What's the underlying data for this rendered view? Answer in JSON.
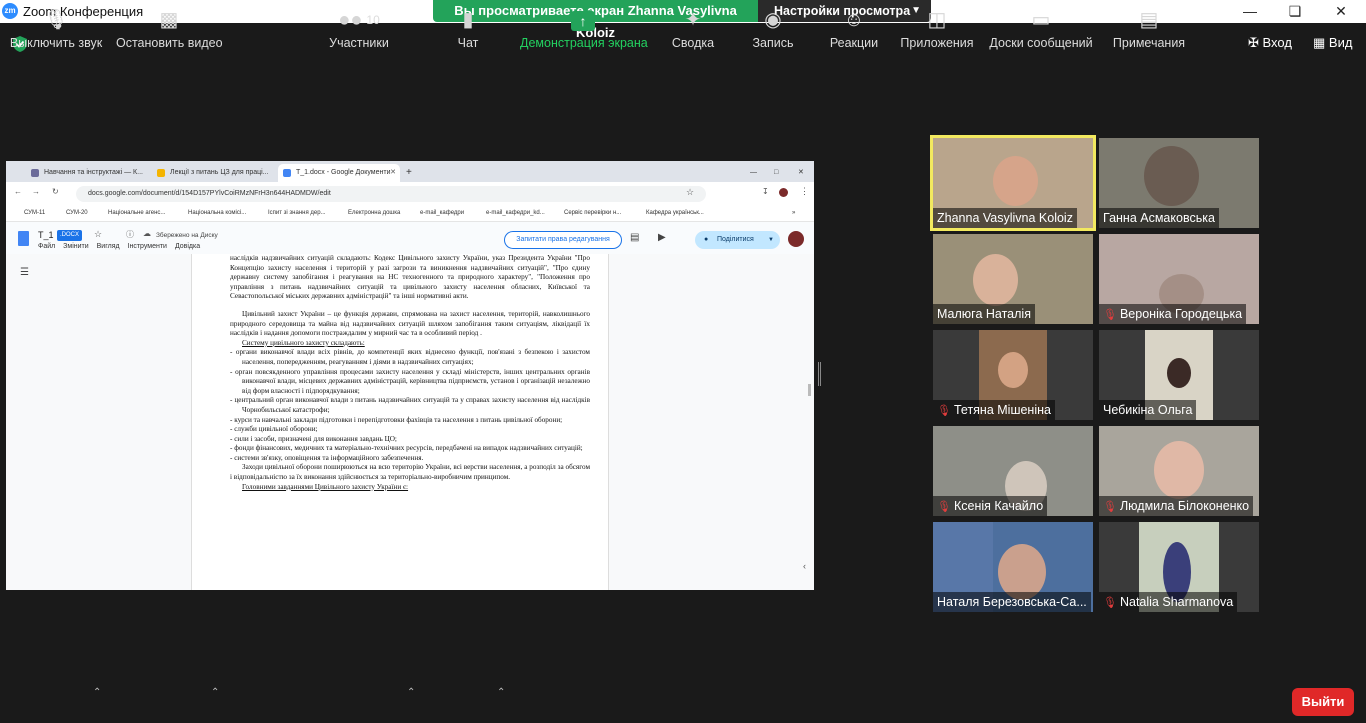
{
  "window": {
    "title": "Zoom Конференция",
    "app_icon_text": "zm"
  },
  "banner": {
    "viewing": "Вы просматриваете экран Zhanna Vasylivna Koloiz",
    "view_options": "Настройки просмотра"
  },
  "top_right": {
    "enter": "Вход",
    "view": "Вид"
  },
  "browser": {
    "tabs": [
      {
        "label": "Навчання та інструктажі — К...",
        "active": false
      },
      {
        "label": "Лекції з питань ЦЗ для праці...",
        "active": false
      },
      {
        "label": "T_1.docx - Google Документи",
        "active": true
      }
    ],
    "url": "docs.google.com/document/d/154D157PYlvCoiRMzNFrH3n644HADMDW/edit",
    "bookmarks": [
      "СУМ-11",
      "СУМ-20",
      "Національне агенс...",
      "Національна комісі...",
      "Іспит зі знання дер...",
      "Електронна дошка",
      "e-mail_кафедри",
      "e-mail_кафедри_kd...",
      "Сервіс перевірки н...",
      "Кафедра українськ..."
    ]
  },
  "docs": {
    "title": "T_1",
    "badge": ".DOCX",
    "saved": "Збережено на Диску",
    "menus": [
      "Файл",
      "Змінити",
      "Вигляд",
      "Інструменти",
      "Довідка"
    ],
    "request_edit": "Запитати права редагування",
    "share": "Поділитися"
  },
  "document": {
    "lines": [
      {
        "text": "наслідків надзвичайних ситуацій складають: Кодекс Цивільного захисту України, указ Президента України \"Про Концепцію захисту населення і територій у разі загрози та виникнення надзвичайних ситуацій\", \"Про єдину державну систему запобігання і реагування на НС техногенного та природного характеру\", \"Положення про управління з питань надзвичайних ситуацій та цивільного захисту населення обласних, Київської та Севастопольської міських державних адміністрацій\" та інші нормативні акти.",
        "style": "para"
      },
      {
        "text": "",
        "style": "gap"
      },
      {
        "text": "Цивільний захист України – це функція держави, спрямована на захист населення, територій, навколишнього природного середовища та майна від надзвичайних ситуацій шляхом запобігання таким ситуаціям, ліквідації їх наслідків і надання допомоги постраждалим у мирний час та в особливий період .",
        "style": "ind"
      },
      {
        "text": "Систему цивільного захисту складають:",
        "style": "ind-u"
      },
      {
        "text": "-    органи виконавчої влади всіх рівнів, до компетенції яких віднесено функції, пов'язані з безпекою і захистом населення, попередженням, реагуванням і діями в надзвичайних ситуаціях;",
        "style": "li"
      },
      {
        "text": "-    орган повсякденного управління процесами захисту населення у складі міністерств, інших центральних органів виконавчої влади, місцевих державних адміністрацій, керівництва підприємств, установ і організацій незалежно від форм власності і підпорядкування;",
        "style": "li"
      },
      {
        "text": "-    центральний орган виконавчої влади з питань надзвичайних ситуацій та у справах захисту населення від наслідків Чорнобильської катастрофи;",
        "style": "li"
      },
      {
        "text": "-    курси та навчальні заклади підготовки і перепідготовки фахівців та населення з питань цивільної оборони;",
        "style": "li"
      },
      {
        "text": "-    служби цивільної оборони;",
        "style": "li"
      },
      {
        "text": "-    сили і засоби, призначені для виконання завдань ЦО;",
        "style": "li"
      },
      {
        "text": "-    фонди фінансових, медичних та матеріально-технічних ресурсів, передбачені на випадок надзвичайних ситуацій;",
        "style": "li"
      },
      {
        "text": "-    системи зв'язку, оповіщення та інформаційного забезпечення.",
        "style": "li"
      },
      {
        "text": "Заходи цивільної оборони поширюються на всю територію України, всі верстви населення, а розподіл за обсягом і відповідальністю за їх виконання здійснюється за територіально-виробничим принципом.",
        "style": "ind"
      },
      {
        "text": "Головними завданнями Цивільного захисту  України є:",
        "style": "ind-u"
      }
    ]
  },
  "participants": [
    {
      "name": "Zhanna Vasylivna Koloiz",
      "muted": false,
      "speaking": true
    },
    {
      "name": "Ганна Асмаковська",
      "muted": false,
      "speaking": false
    },
    {
      "name": "Малюга Наталія",
      "muted": false,
      "speaking": false
    },
    {
      "name": "Вероніка Городецька",
      "muted": true,
      "speaking": false
    },
    {
      "name": "Тетяна Мішеніна",
      "muted": true,
      "speaking": false
    },
    {
      "name": "Чебикіна Ольга",
      "muted": false,
      "speaking": false
    },
    {
      "name": "Ксенія Качайло",
      "muted": true,
      "speaking": false
    },
    {
      "name": "Людмила Білоконенко",
      "muted": true,
      "speaking": false
    },
    {
      "name": "Наталя Березовська-Са...",
      "muted": false,
      "speaking": false
    },
    {
      "name": "Natalia Sharmanova",
      "muted": true,
      "speaking": false
    }
  ],
  "toolbar": {
    "mute": "Выключить звук",
    "video": "Остановить видео",
    "participants": "Участники",
    "participants_count": "10",
    "chat": "Чат",
    "share": "Демонстрация экрана",
    "summary": "Сводка",
    "record": "Запись",
    "reactions": "Реакции",
    "apps": "Приложения",
    "boards": "Доски сообщений",
    "notes": "Примечания",
    "leave": "Выйти"
  },
  "colors": {
    "share_green": "#23a35a",
    "leave_red": "#e02828",
    "speaking_border": "#f2e95f",
    "docs_blue": "#1a73e8"
  }
}
